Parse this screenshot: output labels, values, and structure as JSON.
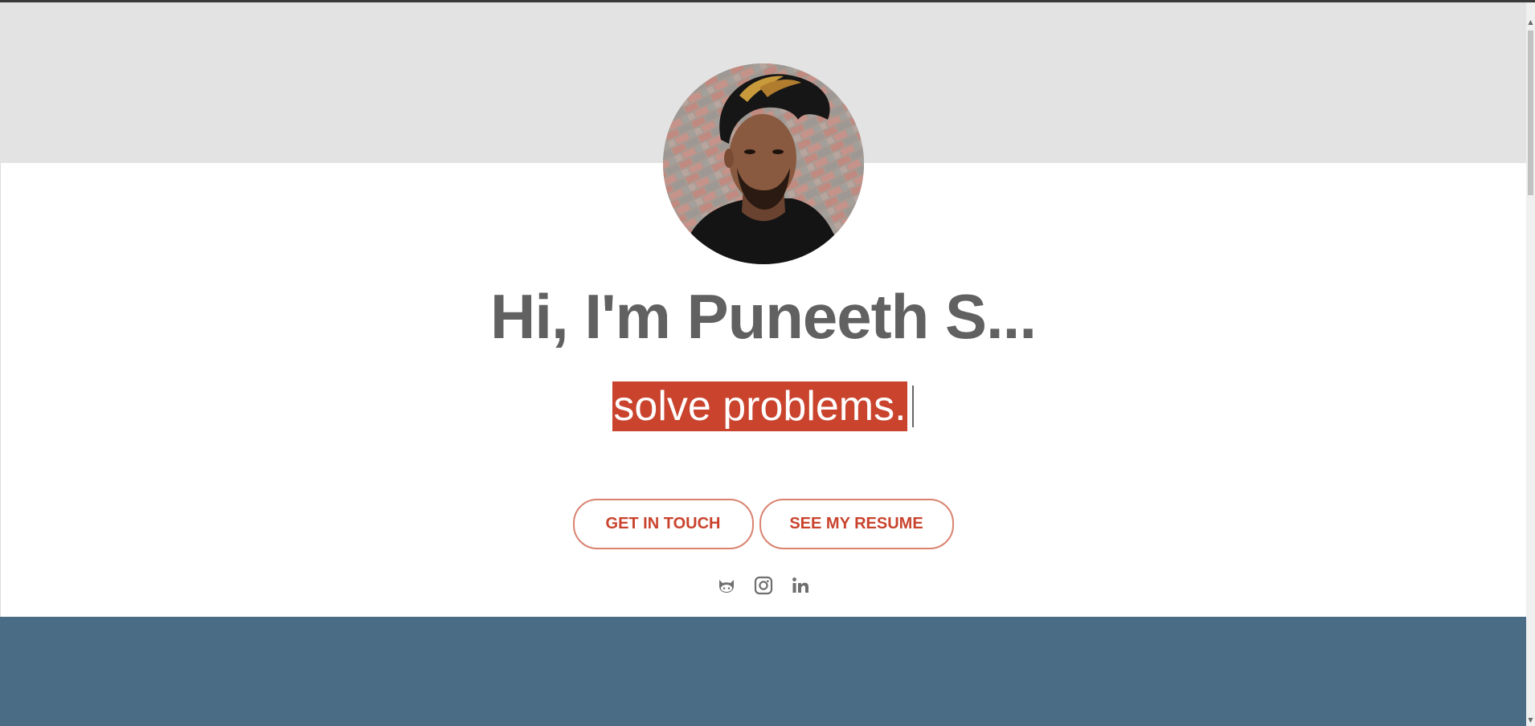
{
  "hero": {
    "headline": "Hi, I'm Puneeth S...",
    "tagline": "solve problems."
  },
  "buttons": {
    "get_in_touch": "GET IN TOUCH",
    "see_resume": "SEE MY RESUME"
  },
  "socials": [
    {
      "icon": "github-icon"
    },
    {
      "icon": "instagram-icon"
    },
    {
      "icon": "linkedin-icon"
    }
  ],
  "colors": {
    "accent": "#c9432d",
    "button_border": "#d9826f",
    "headline": "#616161",
    "hero_band": "#e3e3e3",
    "bottom_section": "#4a6c85",
    "social_icons": "#6f6f6f"
  },
  "scrollbar": {
    "up_glyph": "▲",
    "down_glyph": "▼"
  }
}
